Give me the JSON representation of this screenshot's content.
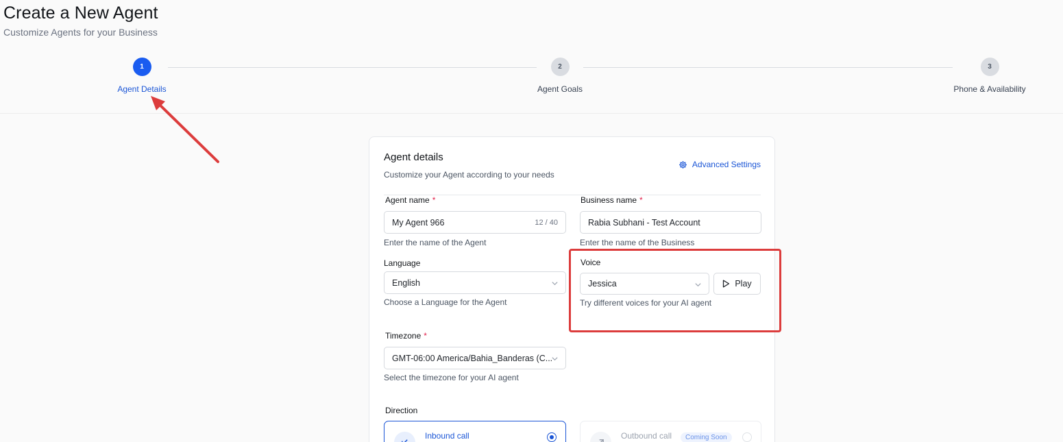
{
  "page": {
    "title": "Create a New Agent",
    "subtitle": "Customize Agents for your Business"
  },
  "stepper": {
    "steps": [
      {
        "number": "1",
        "label": "Agent Details",
        "state": "active"
      },
      {
        "number": "2",
        "label": "Agent Goals",
        "state": "inactive"
      },
      {
        "number": "3",
        "label": "Phone & Availability",
        "state": "inactive"
      }
    ]
  },
  "card": {
    "title": "Agent details",
    "subtitle": "Customize your Agent according to your needs",
    "advanced_settings": "Advanced Settings"
  },
  "form": {
    "agent_name": {
      "label": "Agent name",
      "value": "My Agent 966",
      "counter": "12 / 40",
      "hint": "Enter the name of the Agent",
      "required": true
    },
    "business_name": {
      "label": "Business name",
      "value": "Rabia Subhani - Test Account",
      "hint": "Enter the name of the Business",
      "required": true
    },
    "language": {
      "label": "Language",
      "value": "English",
      "hint": "Choose a Language for the Agent"
    },
    "voice": {
      "label": "Voice",
      "value": "Jessica",
      "hint": "Try different voices for your AI agent",
      "play_label": "Play"
    },
    "timezone": {
      "label": "Timezone",
      "value": "GMT-06:00 America/Bahia_Banderas (C...",
      "hint": "Select the timezone for your AI agent",
      "required": true
    },
    "direction": {
      "label": "Direction",
      "options": [
        {
          "label": "Inbound call",
          "selected": true
        },
        {
          "label": "Outbound call",
          "selected": false,
          "badge": "Coming Soon",
          "disabled": true
        }
      ]
    }
  },
  "colors": {
    "accent": "#1a55d6",
    "annotation_red": "#dc3c3c",
    "required_star": "#e11d48"
  },
  "icons": {
    "advanced_settings": "gear-icon",
    "dropdown": "chevron-down-icon",
    "play": "play-icon",
    "inbound": "arrow-down-left-icon",
    "outbound": "arrow-up-right-icon"
  }
}
